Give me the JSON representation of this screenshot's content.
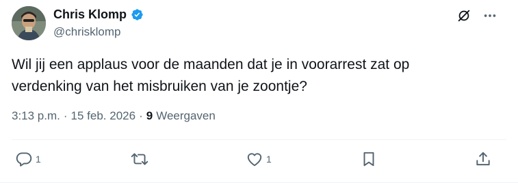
{
  "author": {
    "display_name": "Chris Klomp",
    "handle": "@chrisklomp",
    "verified_color": "#1d9bf0"
  },
  "post": {
    "text": "Wil jij een applaus voor de maanden dat je in voorarrest zat op\nverdenking van het misbruiken van je zoontje?",
    "time": "3:13 p.m.",
    "separator": "·",
    "date": "15 feb. 2026",
    "views_count": "9",
    "views_label": "Weergaven"
  },
  "top_actions": {
    "icons": [
      "grok-icon",
      "more-icon"
    ]
  },
  "actions": {
    "reply_count": "1",
    "repost_count": "",
    "like_count": "1",
    "icons": [
      "reply-icon",
      "repost-icon",
      "like-icon",
      "bookmark-icon",
      "share-icon"
    ]
  },
  "colors": {
    "text_primary": "#0f1419",
    "text_secondary": "#536471",
    "divider": "#eff3f4",
    "accent": "#1d9bf0"
  }
}
